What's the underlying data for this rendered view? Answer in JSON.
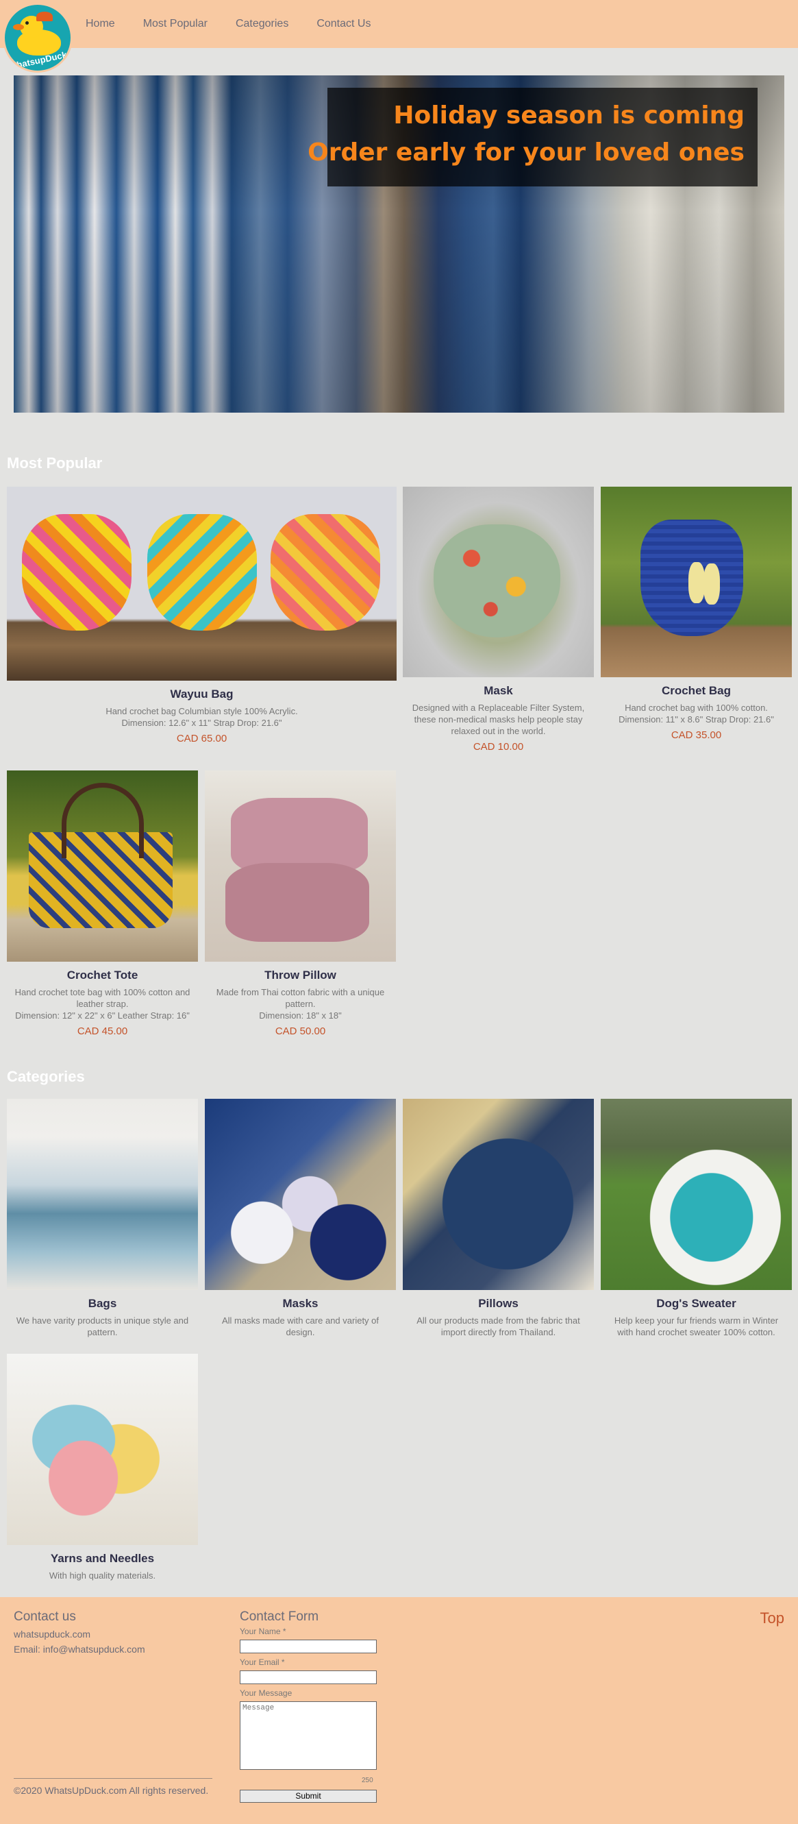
{
  "header": {
    "logo_text": "WhatsupDuck",
    "nav": [
      "Home",
      "Most Popular",
      "Categories",
      "Contact Us"
    ]
  },
  "hero": {
    "line1": "Holiday season is coming",
    "line2": "Order early for your loved ones"
  },
  "most_popular": {
    "title": "Most Popular",
    "items": [
      {
        "name": "Wayuu Bag",
        "desc": "Hand crochet bag Columbian style 100% Acrylic.\nDimension: 12.6\" x 11\" Strap Drop: 21.6\"",
        "price": "CAD 65.00"
      },
      {
        "name": "Mask",
        "desc": "Designed with a Replaceable Filter System, these non-medical masks help people stay relaxed out in the world.",
        "price": "CAD 10.00"
      },
      {
        "name": "Crochet Bag",
        "desc": "Hand crochet bag with 100% cotton.\nDimension: 11\" x 8.6\" Strap Drop: 21.6\"",
        "price": "CAD 35.00"
      },
      {
        "name": "Crochet Tote",
        "desc": "Hand crochet tote bag with 100% cotton and leather strap.\nDimension: 12\" x 22\" x 6\" Leather Strap: 16\"",
        "price": "CAD 45.00"
      },
      {
        "name": "Throw Pillow",
        "desc": "Made from Thai cotton fabric with a unique pattern.\nDimension: 18\" x 18\"",
        "price": "CAD 50.00"
      }
    ]
  },
  "categories": {
    "title": "Categories",
    "items": [
      {
        "name": "Bags",
        "desc": "We have varity products in unique style and pattern."
      },
      {
        "name": "Masks",
        "desc": "All masks made with care and variety of design."
      },
      {
        "name": "Pillows",
        "desc": "All our products made from the fabric that import directly from Thailand."
      },
      {
        "name": "Dog's Sweater",
        "desc": "Help keep your fur friends warm in Winter with hand crochet sweater 100% cotton."
      },
      {
        "name": "Yarns and Needles",
        "desc": "With high quality materials."
      }
    ]
  },
  "footer": {
    "contact_title": "Contact us",
    "site": "whatsupduck.com",
    "email": "Email: info@whatsupduck.com",
    "copyright": "©2020 WhatsUpDuck.com All rights reserved.",
    "form_title": "Contact Form",
    "name_label": "Your Name *",
    "email_label": "Your Email *",
    "message_label": "Your Message",
    "message_placeholder": "Message",
    "counter": "250",
    "submit": "Submit",
    "top": "Top"
  },
  "colors": {
    "header_bg": "#f8c9a2",
    "page_bg": "#e3e3e1",
    "accent": "#f7861c",
    "price": "#c4532a"
  }
}
